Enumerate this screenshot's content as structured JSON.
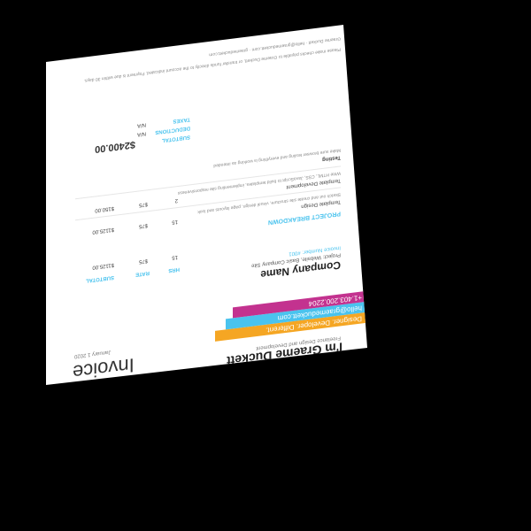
{
  "header": {
    "name": "I'm Graeme Duckett",
    "tagline": "Freelance Design and Development",
    "bands": [
      "Designer. Developer. Different.",
      "hello@graemeduckett.com",
      "+1.403.200.2204"
    ]
  },
  "invoice": {
    "title": "Invoice",
    "date": "January 1 2020"
  },
  "client": {
    "company": "Company Name",
    "project_label": "Project: Website, Basic Company Site",
    "invoice_number": "Invoice Number: #001"
  },
  "columns": {
    "hrs": "HRS",
    "rate": "RATE",
    "subtotal": "SUBTOTAL"
  },
  "first_row": {
    "hrs": "15",
    "rate": "$75",
    "subtotal": "$1125.00"
  },
  "section_title": "PROJECT BREAKDOWN",
  "items": [
    {
      "name": "Template Design",
      "desc": "Sketch out and create site structure, visual design, page layouts and look",
      "hrs": "15",
      "rate": "$75",
      "subtotal": "$1125.00"
    },
    {
      "name": "Template Development",
      "desc": "Write HTML, CSS, JavaScript to build templates, implementing site responsiveness",
      "hrs": "2",
      "rate": "$75",
      "subtotal": "$150.00"
    },
    {
      "name": "Testing",
      "desc": "Make sure browser testing and everything is working as intended",
      "hrs": "",
      "rate": "",
      "subtotal": ""
    }
  ],
  "totals": {
    "subtotal_label": "SUBTOTAL",
    "deductions_label": "DEDUCTIONS",
    "deductions_value": "N/A",
    "taxes_label": "TAXES",
    "taxes_value": "N/A",
    "total": "$2400.00"
  },
  "footer": {
    "note": "Please make checks payable to Graeme Duckett, or transfer funds directly to the account indicated. Payment is due within 30 days.",
    "contact": "Graeme Duckett  ·  hello@graemeduckett.com  ·  graemeduckett.com"
  },
  "colors": {
    "orange": "#f5a623",
    "cyan": "#4ac3ee",
    "magenta": "#c3328f"
  }
}
